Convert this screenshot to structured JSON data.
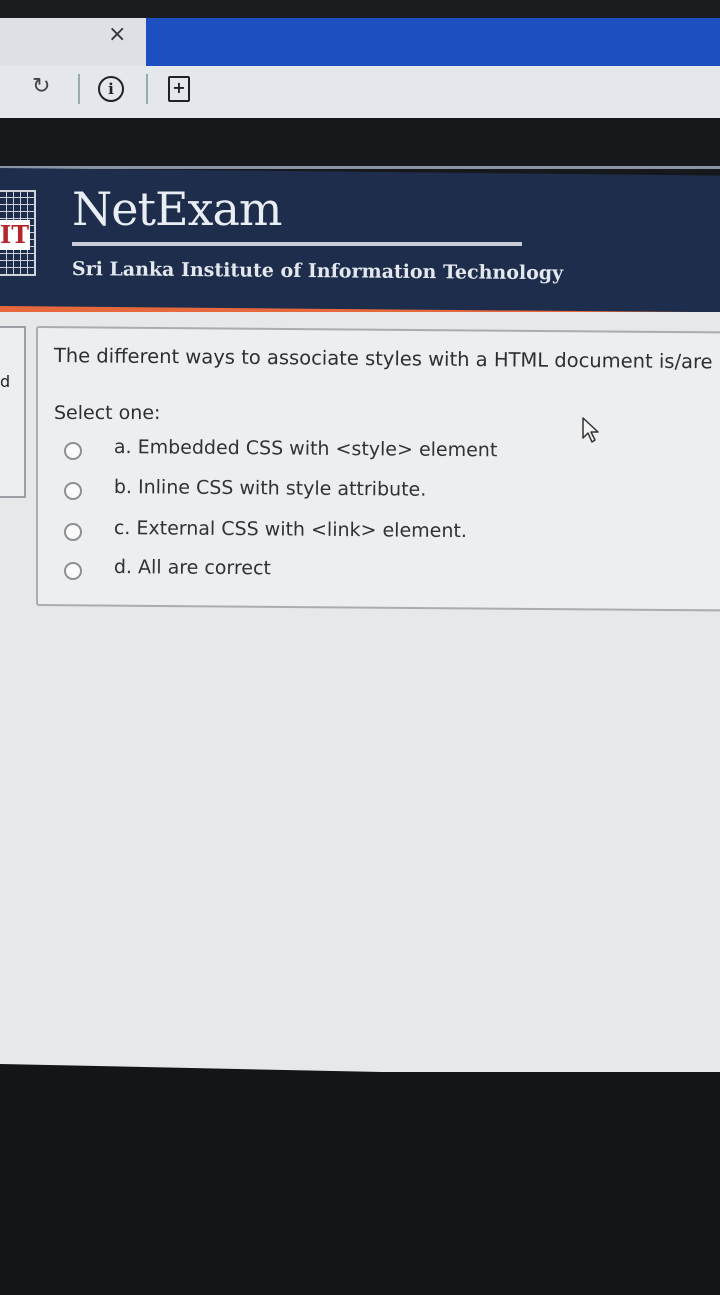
{
  "browser": {
    "close_glyph": "×",
    "reload_glyph": "↻",
    "info_glyph": "i",
    "page_glyph": "+",
    "icons": [
      "close-icon",
      "reload-icon",
      "info-icon",
      "page-action-icon"
    ]
  },
  "header": {
    "brand": "NetExam",
    "institute": "Sri Lanka Institute of Information Technology",
    "logo_text": "IT",
    "colors": {
      "header_bg": "#1e2d4c",
      "accent_bar": "#e8683d"
    }
  },
  "question": {
    "text": "The different ways to associate styles with a HTML document is/are",
    "prompt": "Select one:",
    "options": [
      {
        "label": "a. Embedded CSS with <style> element"
      },
      {
        "label": "b. Inline CSS with style attribute."
      },
      {
        "label": "c. External CSS with <link> element."
      },
      {
        "label": "d. All are correct"
      }
    ]
  },
  "left_panel": {
    "glyph": "d"
  }
}
